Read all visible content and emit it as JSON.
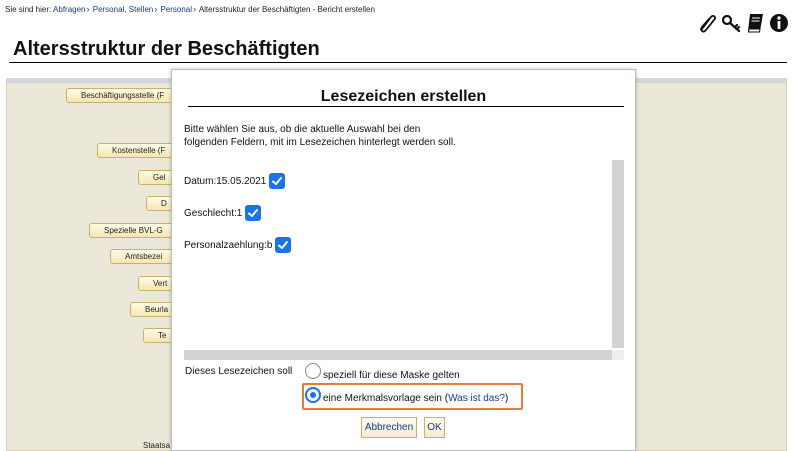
{
  "breadcrumb": {
    "prefix": "Sie sind hier:",
    "items": [
      "Abfragen",
      "Personal, Stellen",
      "Personal"
    ],
    "current": "Altersstruktur der Beschäftigten - Bericht erstellen"
  },
  "toolbar": {
    "icons": [
      "paperclip-icon",
      "keys-icon",
      "book-icon",
      "info-icon"
    ]
  },
  "page": {
    "title": "Altersstruktur der Beschäftigten"
  },
  "background_form": {
    "fields": [
      "Beschäftigungsstelle (F",
      "Kostenstelle (F",
      "Gel",
      "D",
      "Spezielle BVL-G",
      "Amtsbezei",
      "Vert",
      "Beurla",
      "Te"
    ],
    "bottom_label": "Staatsa"
  },
  "dialog": {
    "title": "Lesezeichen erstellen",
    "intro_line1": "Bitte wählen Sie aus, ob die aktuelle Auswahl bei den",
    "intro_line2": "folgenden Feldern, mit im Lesezeichen hinterlegt werden soll.",
    "options": [
      {
        "label": "Datum:15.05.2021",
        "checked": true
      },
      {
        "label": "Geschlecht:1",
        "checked": true
      },
      {
        "label": "Personalzaehlung:b",
        "checked": true
      }
    ],
    "scope_label": "Dieses Lesezeichen soll",
    "radio_mask": "speziell für diese Maske gelten",
    "radio_template": "eine Merkmalsvorlage sein (",
    "help_link": "Was ist das?",
    "radio_template_end": ")",
    "selected_radio": "template",
    "cancel_label": "Abbrechen",
    "ok_label": "OK"
  },
  "colors": {
    "accent": "#1a73e8",
    "highlight": "#e87a3a",
    "link": "#1a3a8a",
    "form_bg": "#ece8d9"
  }
}
